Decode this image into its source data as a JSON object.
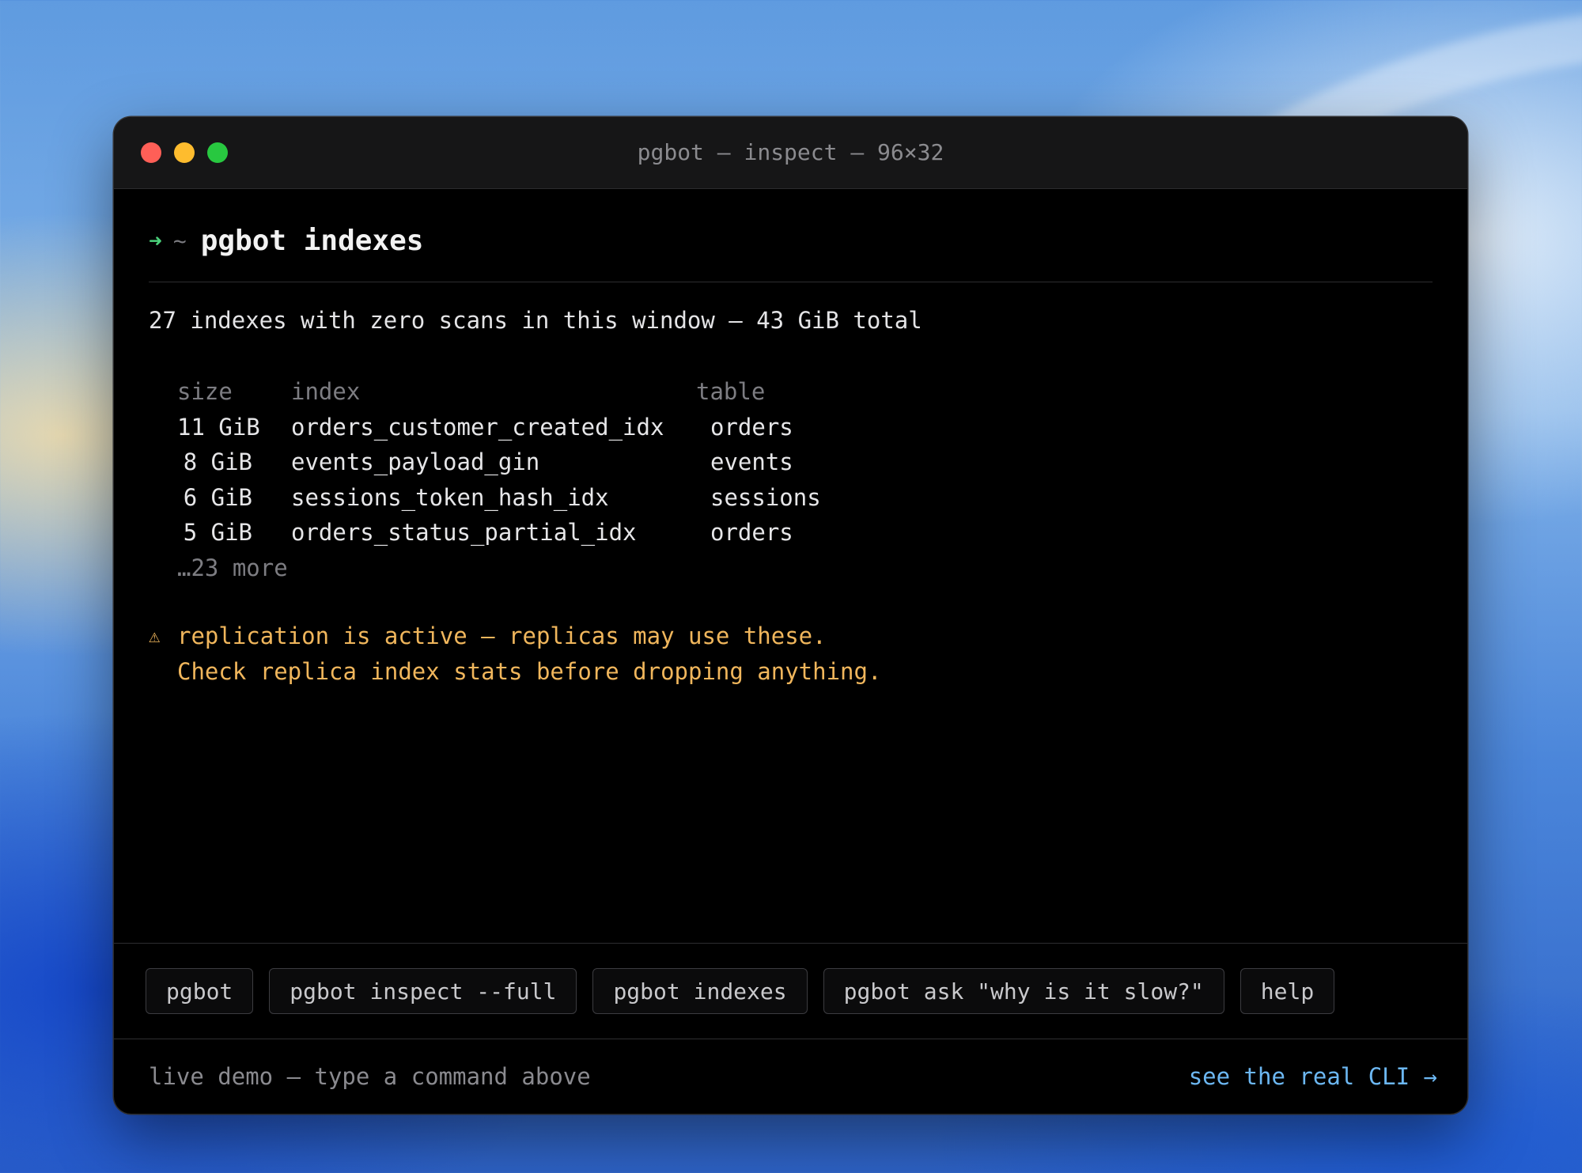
{
  "window": {
    "title": "pgbot — inspect — 96×32"
  },
  "prompt": {
    "arrow": "➜",
    "cwd": "~",
    "command": "pgbot indexes"
  },
  "output": {
    "summary": "27 indexes with zero scans in this window — 43 GiB total",
    "table": {
      "headers": {
        "size": "size",
        "index": "index",
        "table": "table"
      },
      "rows": [
        {
          "size": "11 GiB",
          "index": "orders_customer_created_idx",
          "table": "orders"
        },
        {
          "size": "8 GiB",
          "index": "events_payload_gin",
          "table": "events"
        },
        {
          "size": "6 GiB",
          "index": "sessions_token_hash_idx",
          "table": "sessions"
        },
        {
          "size": "5 GiB",
          "index": "orders_status_partial_idx",
          "table": "orders"
        }
      ],
      "more": "…23 more"
    },
    "warning": {
      "icon": "⚠",
      "icon_name": "warning-icon",
      "line1": "replication is active — replicas may use these.",
      "line2": "Check replica index stats before dropping anything."
    }
  },
  "commands": [
    {
      "label": "pgbot"
    },
    {
      "label": "pgbot inspect --full"
    },
    {
      "label": "pgbot indexes"
    },
    {
      "label": "pgbot ask \"why is it slow?\""
    },
    {
      "label": "help"
    }
  ],
  "footer": {
    "hint": "live demo — type a command above",
    "link": "see the real CLI →"
  },
  "colors": {
    "prompt_arrow": "#4ad07a",
    "warning": "#f0b65c",
    "link": "#6cb7f2",
    "close": "#ff5f57",
    "minimize": "#febc2e",
    "zoom": "#28c840"
  }
}
